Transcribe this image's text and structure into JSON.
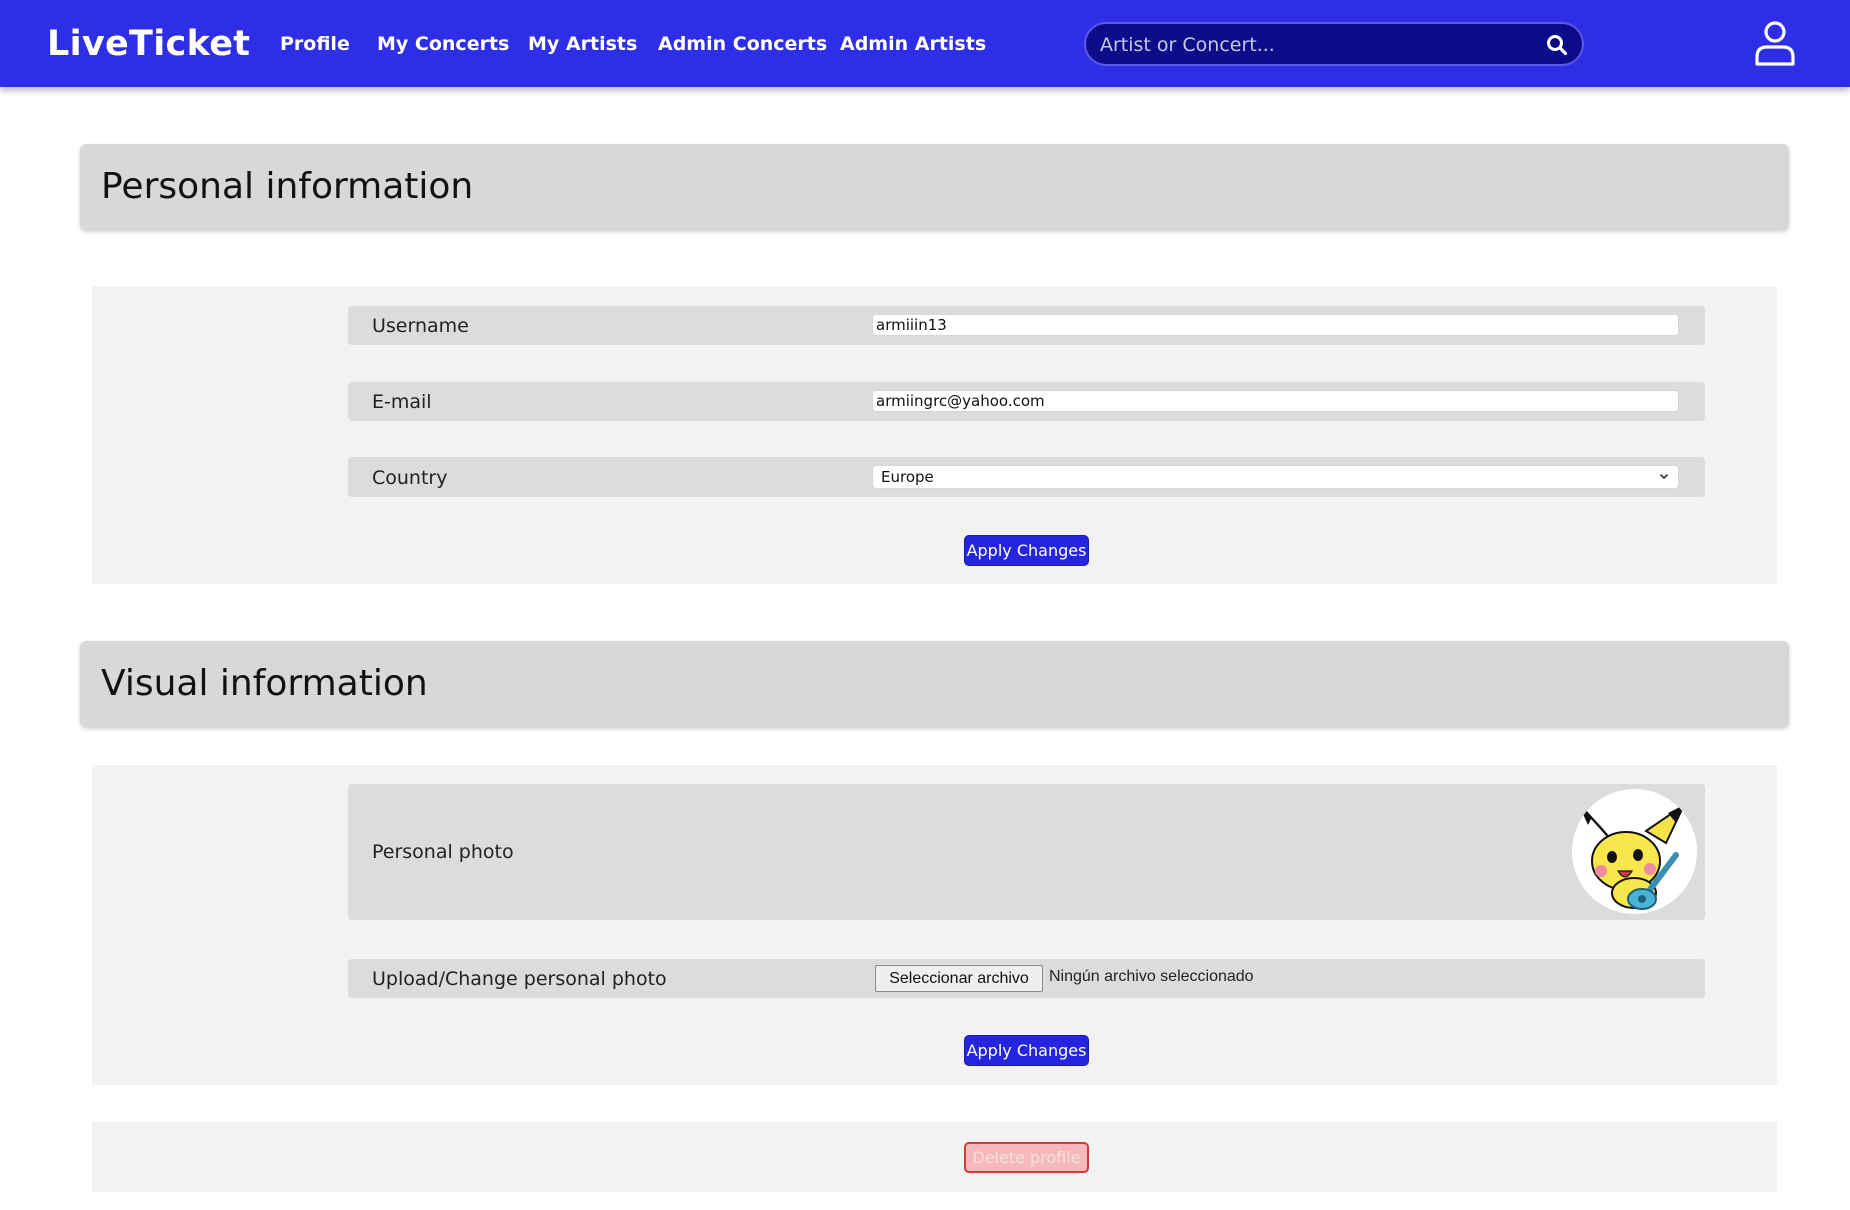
{
  "navbar": {
    "brand": "LiveTicket",
    "links": [
      "Profile",
      "My Concerts",
      "My Artists",
      "Admin Concerts",
      "Admin Artists"
    ],
    "search_placeholder": "Artist or Concert...",
    "colors": {
      "bar": "#2e2ee6",
      "search_bg": "#0c0c8a"
    }
  },
  "personal": {
    "title": "Personal information",
    "username_label": "Username",
    "username_value": "armiiin13",
    "email_label": "E-mail",
    "email_value": "armiingrc@yahoo.com",
    "country_label": "Country",
    "country_value": "Europe",
    "apply_label": "Apply Changes"
  },
  "visual": {
    "title": "Visual information",
    "photo_label": "Personal photo",
    "upload_label": "Upload/Change personal photo",
    "file_button_label": "Seleccionar archivo",
    "file_status": "Ningún archivo seleccionado",
    "apply_label": "Apply Changes"
  },
  "danger": {
    "delete_label": "Delete profile",
    "colors": {
      "fill": "#f6b8bb",
      "border": "#d13a3a"
    }
  },
  "icons": {
    "search": "search-icon",
    "user": "user-icon",
    "chevron": "chevron-down-icon"
  }
}
